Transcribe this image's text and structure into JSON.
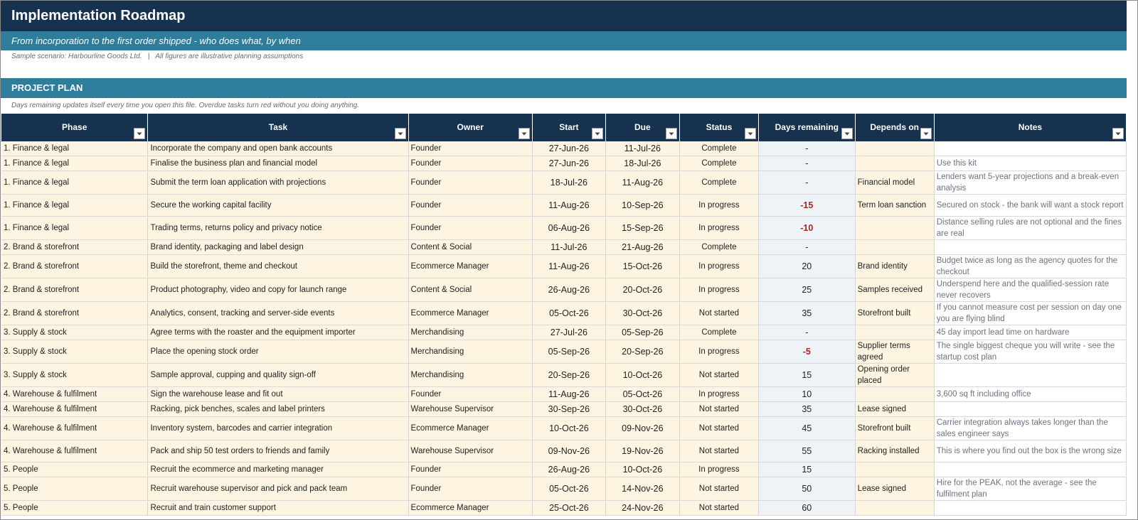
{
  "title": "Implementation Roadmap",
  "subtitle": "From incorporation to the first order shipped - who does what, by when",
  "scenario": "Sample scenario: Harbourline Goods Ltd.   |   All figures are illustrative planning assumptions",
  "section": {
    "title": "PROJECT PLAN",
    "note": "Days remaining updates itself every time you open this file. Overdue tasks turn red without you doing anything."
  },
  "columns": [
    "Phase",
    "Task",
    "Owner",
    "Start",
    "Due",
    "Status",
    "Days remaining",
    "Depends on",
    "Notes"
  ],
  "colors": {
    "header_navy": "#17324f",
    "teal": "#2e7d9a",
    "input_fill": "#fdf5e1",
    "calc_fill": "#eef3f8",
    "overdue_red": "#b22222"
  },
  "rows": [
    {
      "phase": "1. Finance & legal",
      "task": "Incorporate the company and open bank accounts",
      "owner": "Founder",
      "start": "27-Jun-26",
      "due": "11-Jul-26",
      "status": "Complete",
      "days": "-",
      "overdue": false,
      "depends": "",
      "notes": "",
      "tall": false
    },
    {
      "phase": "1. Finance & legal",
      "task": "Finalise the business plan and financial model",
      "owner": "Founder",
      "start": "27-Jun-26",
      "due": "18-Jul-26",
      "status": "Complete",
      "days": "-",
      "overdue": false,
      "depends": "",
      "notes": "Use this kit",
      "tall": false
    },
    {
      "phase": "1. Finance & legal",
      "task": "Submit the term loan application with projections",
      "owner": "Founder",
      "start": "18-Jul-26",
      "due": "11-Aug-26",
      "status": "Complete",
      "days": "-",
      "overdue": false,
      "depends": "Financial model",
      "notes": "Lenders want 5-year projections and a break-even analysis",
      "tall": true
    },
    {
      "phase": "1. Finance & legal",
      "task": "Secure the working capital facility",
      "owner": "Founder",
      "start": "11-Aug-26",
      "due": "10-Sep-26",
      "status": "In progress",
      "days": "-15",
      "overdue": true,
      "depends": "Term loan sanction",
      "notes": "Secured on stock - the bank will want a stock report",
      "tall": true
    },
    {
      "phase": "1. Finance & legal",
      "task": "Trading terms, returns policy and privacy notice",
      "owner": "Founder",
      "start": "06-Aug-26",
      "due": "15-Sep-26",
      "status": "In progress",
      "days": "-10",
      "overdue": true,
      "depends": "",
      "notes": "Distance selling rules are not optional and the fines are real",
      "tall": true
    },
    {
      "phase": "2. Brand & storefront",
      "task": "Brand identity, packaging and label design",
      "owner": "Content & Social",
      "start": "11-Jul-26",
      "due": "21-Aug-26",
      "status": "Complete",
      "days": "-",
      "overdue": false,
      "depends": "",
      "notes": "",
      "tall": false
    },
    {
      "phase": "2. Brand & storefront",
      "task": "Build the storefront, theme and checkout",
      "owner": "Ecommerce Manager",
      "start": "11-Aug-26",
      "due": "15-Oct-26",
      "status": "In progress",
      "days": "20",
      "overdue": false,
      "depends": "Brand identity",
      "notes": "Budget twice as long as the agency quotes for the checkout",
      "tall": true
    },
    {
      "phase": "2. Brand & storefront",
      "task": "Product photography, video and copy for launch range",
      "owner": "Content & Social",
      "start": "26-Aug-26",
      "due": "20-Oct-26",
      "status": "In progress",
      "days": "25",
      "overdue": false,
      "depends": "Samples received",
      "notes": "Underspend here and the qualified-session rate never recovers",
      "tall": true
    },
    {
      "phase": "2. Brand & storefront",
      "task": "Analytics, consent, tracking and server-side events",
      "owner": "Ecommerce Manager",
      "start": "05-Oct-26",
      "due": "30-Oct-26",
      "status": "Not started",
      "days": "35",
      "overdue": false,
      "depends": "Storefront built",
      "notes": "If you cannot measure cost per session on day one you are flying blind",
      "tall": true
    },
    {
      "phase": "3. Supply & stock",
      "task": "Agree terms with the roaster and the equipment importer",
      "owner": "Merchandising",
      "start": "27-Jul-26",
      "due": "05-Sep-26",
      "status": "Complete",
      "days": "-",
      "overdue": false,
      "depends": "",
      "notes": "45 day import lead time on hardware",
      "tall": false
    },
    {
      "phase": "3. Supply & stock",
      "task": "Place the opening stock order",
      "owner": "Merchandising",
      "start": "05-Sep-26",
      "due": "20-Sep-26",
      "status": "In progress",
      "days": "-5",
      "overdue": true,
      "depends": "Supplier terms agreed",
      "notes": "The single biggest cheque you will write - see the startup cost plan",
      "tall": true
    },
    {
      "phase": "3. Supply & stock",
      "task": "Sample approval, cupping and quality sign-off",
      "owner": "Merchandising",
      "start": "20-Sep-26",
      "due": "10-Oct-26",
      "status": "Not started",
      "days": "15",
      "overdue": false,
      "depends": "Opening order placed",
      "notes": "",
      "tall": true
    },
    {
      "phase": "4. Warehouse & fulfilment",
      "task": "Sign the warehouse lease and fit out",
      "owner": "Founder",
      "start": "11-Aug-26",
      "due": "05-Oct-26",
      "status": "In progress",
      "days": "10",
      "overdue": false,
      "depends": "",
      "notes": "3,600 sq ft including office",
      "tall": false
    },
    {
      "phase": "4. Warehouse & fulfilment",
      "task": "Racking, pick benches, scales and label printers",
      "owner": "Warehouse Supervisor",
      "start": "30-Sep-26",
      "due": "30-Oct-26",
      "status": "Not started",
      "days": "35",
      "overdue": false,
      "depends": "Lease signed",
      "notes": "",
      "tall": false
    },
    {
      "phase": "4. Warehouse & fulfilment",
      "task": "Inventory system, barcodes and carrier integration",
      "owner": "Ecommerce Manager",
      "start": "10-Oct-26",
      "due": "09-Nov-26",
      "status": "Not started",
      "days": "45",
      "overdue": false,
      "depends": "Storefront built",
      "notes": "Carrier integration always takes longer than the sales engineer says",
      "tall": true
    },
    {
      "phase": "4. Warehouse & fulfilment",
      "task": "Pack and ship 50 test orders to friends and family",
      "owner": "Warehouse Supervisor",
      "start": "09-Nov-26",
      "due": "19-Nov-26",
      "status": "Not started",
      "days": "55",
      "overdue": false,
      "depends": "Racking installed",
      "notes": "This is where you find out the box is the wrong size",
      "tall": true
    },
    {
      "phase": "5. People",
      "task": "Recruit the ecommerce and marketing manager",
      "owner": "Founder",
      "start": "26-Aug-26",
      "due": "10-Oct-26",
      "status": "In progress",
      "days": "15",
      "overdue": false,
      "depends": "",
      "notes": "",
      "tall": false
    },
    {
      "phase": "5. People",
      "task": "Recruit warehouse supervisor and pick and pack team",
      "owner": "Founder",
      "start": "05-Oct-26",
      "due": "14-Nov-26",
      "status": "Not started",
      "days": "50",
      "overdue": false,
      "depends": "Lease signed",
      "notes": "Hire for the PEAK, not the average - see the fulfilment plan",
      "tall": true
    },
    {
      "phase": "5. People",
      "task": "Recruit and train customer support",
      "owner": "Ecommerce Manager",
      "start": "25-Oct-26",
      "due": "24-Nov-26",
      "status": "Not started",
      "days": "60",
      "overdue": false,
      "depends": "",
      "notes": "",
      "tall": false
    }
  ]
}
